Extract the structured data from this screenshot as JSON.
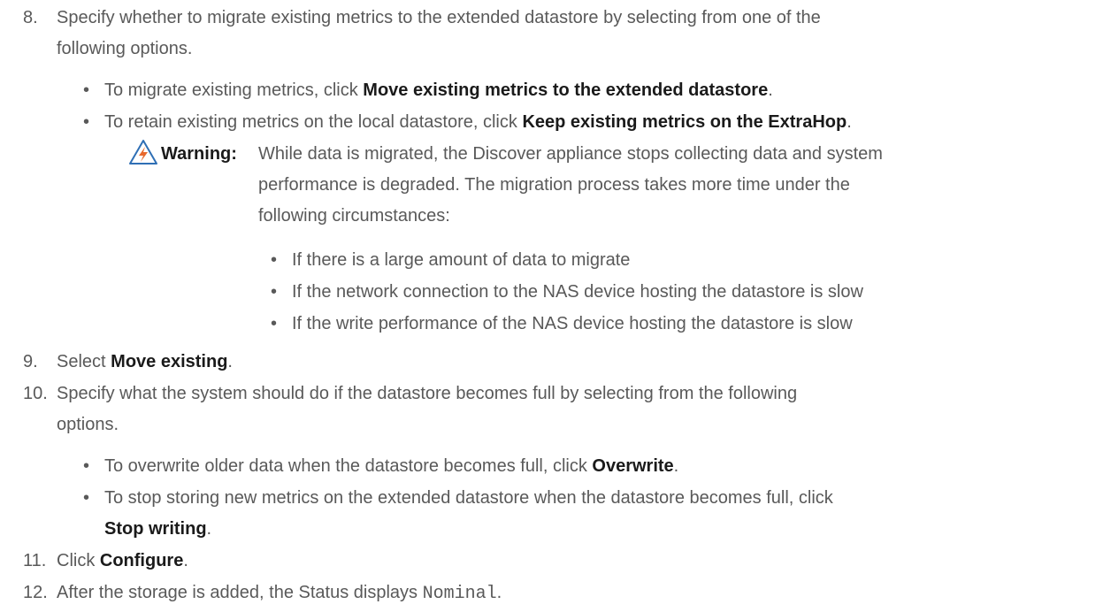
{
  "step8": {
    "number": "8.",
    "line1": "Specify whether to migrate existing metrics to the extended datastore by selecting from one of the",
    "line2": "following options.",
    "options": [
      {
        "pre": "To migrate existing metrics, click ",
        "bold": "Move existing metrics to the extended datastore",
        "post": "."
      },
      {
        "pre": "To retain existing metrics on the local datastore, click ",
        "bold": "Keep existing metrics on the ExtraHop",
        "post": "."
      }
    ]
  },
  "warning": {
    "icon": "warning-icon",
    "label": "Warning:",
    "line1": "While data is migrated, the Discover appliance stops collecting data and system",
    "line2": "performance is degraded. The migration process takes more time under the",
    "line3": "following circumstances:",
    "items": [
      "If there is a large amount of data to migrate",
      "If the network connection to the NAS device hosting the datastore is slow",
      "If the write performance of the NAS device hosting the datastore is slow"
    ]
  },
  "step9": {
    "number": "9.",
    "pre": "Select ",
    "bold": "Move existing",
    "post": "."
  },
  "step10": {
    "number": "10.",
    "line1": "Specify what the system should do if the datastore becomes full by selecting from the following",
    "line2": "options.",
    "opt1": {
      "pre": "To overwrite older data when the datastore becomes full, click ",
      "bold": "Overwrite",
      "post": "."
    },
    "opt2": {
      "line1": "To stop storing new metrics on the extended datastore when the datastore becomes full, click",
      "bold": "Stop writing",
      "post": "."
    }
  },
  "step11": {
    "number": "11.",
    "pre": "Click ",
    "bold": "Configure",
    "post": "."
  },
  "step12": {
    "number": "12.",
    "pre": "After the storage is added, the Status displays ",
    "code": "Nominal",
    "post": "."
  },
  "colors": {
    "text": "#595959",
    "bold": "#1a1a1a",
    "icon_orange": "#e8692d",
    "icon_blue": "#2f6fb5"
  }
}
